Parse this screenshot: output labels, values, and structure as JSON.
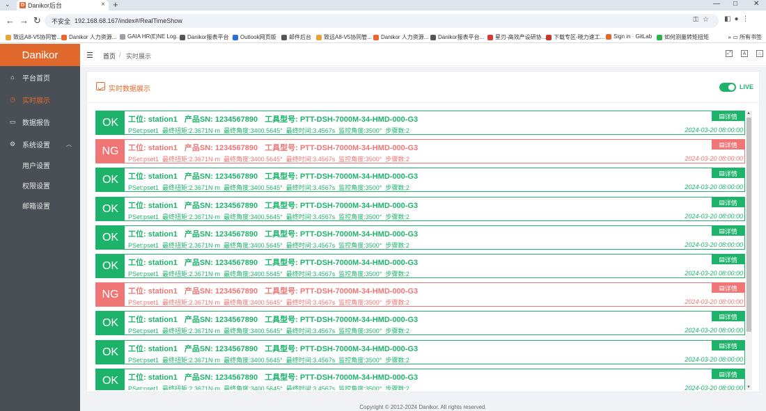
{
  "browser": {
    "tab_title": "Danikor后台",
    "favicon_letter": "D",
    "insecure_label": "不安全",
    "url": "192.168.68.167/index#/RealTimeShow",
    "bookmarks": [
      {
        "label": "致远A8-V5协同管...",
        "color": "#e8a33d"
      },
      {
        "label": "Danikor 人力资源...",
        "color": "#e2692d"
      },
      {
        "label": "GAIA HR(E)NE Log...",
        "color": "#9aa0a6"
      },
      {
        "label": "Danikor报表平台",
        "color": "#555"
      },
      {
        "label": "Outlook网页版",
        "color": "#2a6fd6"
      },
      {
        "label": "邮件后台",
        "color": "#555"
      },
      {
        "label": "致远A8-V5协同管...",
        "color": "#e8a33d"
      },
      {
        "label": "Danikor 人力资源...",
        "color": "#e2692d"
      },
      {
        "label": "Danikor报表平台...",
        "color": "#555"
      },
      {
        "label": "星刃-高效产设研协...",
        "color": "#d93838"
      },
      {
        "label": "下载专区-晓力速工...",
        "color": "#c0392b"
      },
      {
        "label": "Sign in · GitLab",
        "color": "#e2692d"
      },
      {
        "label": "如何测量转矩扭矩",
        "color": "#2bb34a"
      }
    ],
    "all_bookmarks": "所有书签"
  },
  "sidebar": {
    "brand": "Danikor",
    "items": [
      {
        "label": "平台首页",
        "icon": "home-icon"
      },
      {
        "label": "实时展示",
        "icon": "clock-icon"
      },
      {
        "label": "数据报告",
        "icon": "monitor-icon"
      },
      {
        "label": "系统设置",
        "icon": "gear-icon"
      }
    ],
    "sub_items": [
      "用户设置",
      "权限设置",
      "邮箱设置"
    ]
  },
  "breadcrumb": {
    "home": "首页",
    "current": "实时展示"
  },
  "panel": {
    "title": "实时数据展示",
    "live_label": "LIVE"
  },
  "colors": {
    "ok": "#1db36b",
    "ng": "#f07575",
    "accent": "#e2692d"
  },
  "records": [
    {
      "status": "OK",
      "station_label": "工位: station1",
      "sn_label": "产品SN: 1234567890",
      "tool_label": "工具型号: PTT-DSH-7000M-34-HMD-000-G3",
      "pset": "PSet:pset1",
      "torque": "最终扭矩:2.3671N·m",
      "angle": "最终角度:3400.5645°",
      "time": "最终时间:3.4567s",
      "monitor": "监控角度:3500°",
      "steps": "步骤数:2",
      "detail": "详情",
      "timestamp": "2024-03-20 08:00:00"
    },
    {
      "status": "NG",
      "station_label": "工位: station1",
      "sn_label": "产品SN: 1234567890",
      "tool_label": "工具型号: PTT-DSH-7000M-34-HMD-000-G3",
      "pset": "PSet:pset1",
      "torque": "最终扭矩:2.3671N·m",
      "angle": "最终角度:3400.5645°",
      "time": "最终时间:3.4567s",
      "monitor": "监控角度:3500°",
      "steps": "步骤数:2",
      "detail": "详情",
      "timestamp": "2024-03-20 08:00:00"
    },
    {
      "status": "OK",
      "station_label": "工位: station1",
      "sn_label": "产品SN: 1234567890",
      "tool_label": "工具型号: PTT-DSH-7000M-34-HMD-000-G3",
      "pset": "PSet:pset1",
      "torque": "最终扭矩:2.3671N·m",
      "angle": "最终角度:3400.5645°",
      "time": "最终时间:3.4567s",
      "monitor": "监控角度:3500°",
      "steps": "步骤数:2",
      "detail": "详情",
      "timestamp": "2024-03-20 08:00:00"
    },
    {
      "status": "OK",
      "station_label": "工位: station1",
      "sn_label": "产品SN: 1234567890",
      "tool_label": "工具型号: PTT-DSH-7000M-34-HMD-000-G3",
      "pset": "PSet:pset1",
      "torque": "最终扭矩:2.3671N·m",
      "angle": "最终角度:3400.5645°",
      "time": "最终时间:3.4567s",
      "monitor": "监控角度:3500°",
      "steps": "步骤数:2",
      "detail": "详情",
      "timestamp": "2024-03-20 08:00:00"
    },
    {
      "status": "OK",
      "station_label": "工位: station1",
      "sn_label": "产品SN: 1234567890",
      "tool_label": "工具型号: PTT-DSH-7000M-34-HMD-000-G3",
      "pset": "PSet:pset1",
      "torque": "最终扭矩:2.3671N·m",
      "angle": "最终角度:3400.5645°",
      "time": "最终时间:3.4567s",
      "monitor": "监控角度:3500°",
      "steps": "步骤数:2",
      "detail": "详情",
      "timestamp": "2024-03-20 08:00:00"
    },
    {
      "status": "OK",
      "station_label": "工位: station1",
      "sn_label": "产品SN: 1234567890",
      "tool_label": "工具型号: PTT-DSH-7000M-34-HMD-000-G3",
      "pset": "PSet:pset1",
      "torque": "最终扭矩:2.3671N·m",
      "angle": "最终角度:3400.5645°",
      "time": "最终时间:3.4567s",
      "monitor": "监控角度:3500°",
      "steps": "步骤数:2",
      "detail": "详情",
      "timestamp": "2024-03-20 08:00:00"
    },
    {
      "status": "NG",
      "station_label": "工位: station1",
      "sn_label": "产品SN: 1234567890",
      "tool_label": "工具型号: PTT-DSH-7000M-34-HMD-000-G3",
      "pset": "PSet:pset1",
      "torque": "最终扭矩:2.3671N·m",
      "angle": "最终角度:3400.5645°",
      "time": "最终时间:3.4567s",
      "monitor": "监控角度:3500°",
      "steps": "步骤数:2",
      "detail": "详情",
      "timestamp": "2024-03-20 08:00:00"
    },
    {
      "status": "OK",
      "station_label": "工位: station1",
      "sn_label": "产品SN: 1234567890",
      "tool_label": "工具型号: PTT-DSH-7000M-34-HMD-000-G3",
      "pset": "PSet:pset1",
      "torque": "最终扭矩:2.3671N·m",
      "angle": "最终角度:3400.5645°",
      "time": "最终时间:3.4567s",
      "monitor": "监控角度:3500°",
      "steps": "步骤数:2",
      "detail": "详情",
      "timestamp": "2024-03-20 08:00:00"
    },
    {
      "status": "OK",
      "station_label": "工位: station1",
      "sn_label": "产品SN: 1234567890",
      "tool_label": "工具型号: PTT-DSH-7000M-34-HMD-000-G3",
      "pset": "PSet:pset1",
      "torque": "最终扭矩:2.3671N·m",
      "angle": "最终角度:3400.5645°",
      "time": "最终时间:3.4567s",
      "monitor": "监控角度:3500°",
      "steps": "步骤数:2",
      "detail": "详情",
      "timestamp": "2024-03-20 08:00:00"
    },
    {
      "status": "OK",
      "station_label": "工位: station1",
      "sn_label": "产品SN: 1234567890",
      "tool_label": "工具型号: PTT-DSH-7000M-34-HMD-000-G3",
      "pset": "PSet:pset1",
      "torque": "最终扭矩:2.3671N·m",
      "angle": "最终角度:3400.5645°",
      "time": "最终时间:3.4567s",
      "monitor": "监控角度:3500°",
      "steps": "步骤数:2",
      "detail": "详情",
      "timestamp": "2024-03-20 08:00:00"
    }
  ],
  "footer": "Copyright © 2012-2024 Danikor. All rights reserved."
}
